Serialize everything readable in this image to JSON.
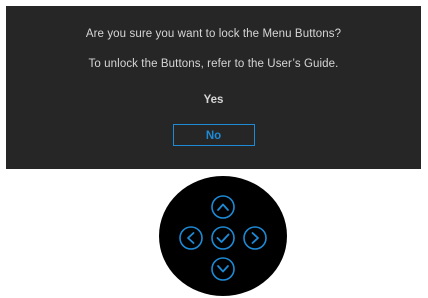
{
  "dialog": {
    "message_line1": "Are you sure you want to lock the Menu Buttons?",
    "message_line2": "To unlock the Buttons, refer to the User’s Guide.",
    "yes_label": "Yes",
    "no_label": "No"
  },
  "joystick": {
    "buttons": [
      "up-arrow",
      "left-arrow",
      "check",
      "right-arrow",
      "down-arrow"
    ],
    "accent_color": "#1e8ad6",
    "body_color": "#000000"
  },
  "colors": {
    "dialog_background": "#262626",
    "text": "#d6d6d6",
    "selected": "#1e8ad6"
  }
}
